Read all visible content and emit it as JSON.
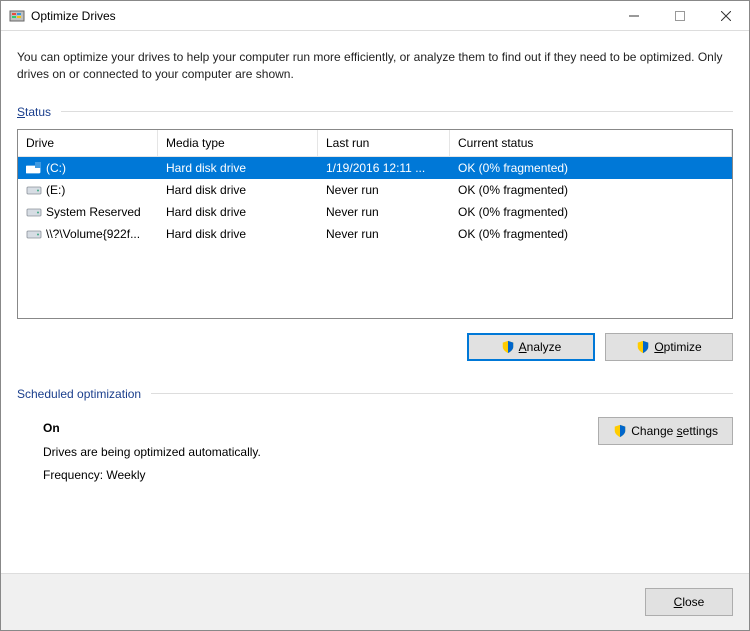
{
  "window": {
    "title": "Optimize Drives"
  },
  "intro": "You can optimize your drives to help your computer run more efficiently, or analyze them to find out if they need to be optimized. Only drives on or connected to your computer are shown.",
  "statusSection": {
    "label": "Status"
  },
  "columns": {
    "drive": "Drive",
    "media": "Media type",
    "last": "Last run",
    "status": "Current status"
  },
  "drives": [
    {
      "name": "(C:)",
      "media": "Hard disk drive",
      "last": "1/19/2016 12:11 ...",
      "status": "OK (0% fragmented)",
      "selected": true,
      "iconType": "os"
    },
    {
      "name": "(E:)",
      "media": "Hard disk drive",
      "last": "Never run",
      "status": "OK (0% fragmented)",
      "selected": false,
      "iconType": "hdd"
    },
    {
      "name": "System Reserved",
      "media": "Hard disk drive",
      "last": "Never run",
      "status": "OK (0% fragmented)",
      "selected": false,
      "iconType": "hdd"
    },
    {
      "name": "\\\\?\\Volume{922f...",
      "media": "Hard disk drive",
      "last": "Never run",
      "status": "OK (0% fragmented)",
      "selected": false,
      "iconType": "hdd"
    }
  ],
  "buttons": {
    "analyze": "Analyze",
    "optimize": "Optimize",
    "changeSettings": "Change settings",
    "close": "Close"
  },
  "schedSection": {
    "label": "Scheduled optimization"
  },
  "schedule": {
    "state": "On",
    "desc": "Drives are being optimized automatically.",
    "freq": "Frequency: Weekly"
  }
}
